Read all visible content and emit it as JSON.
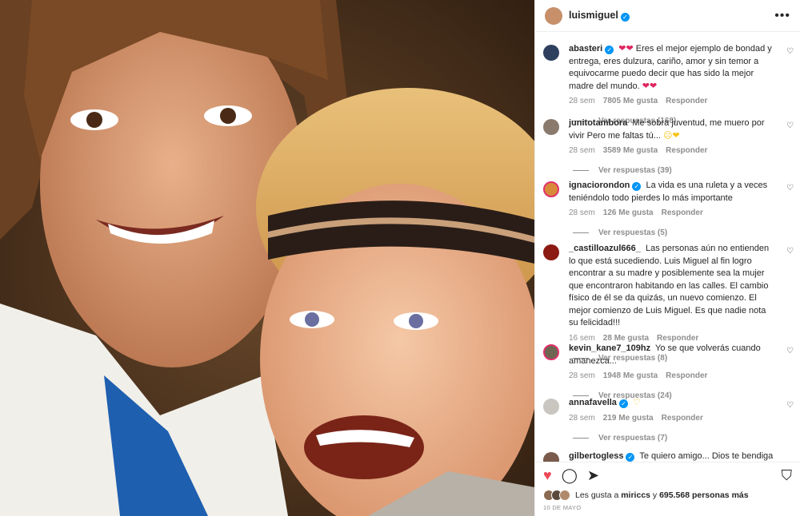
{
  "post": {
    "username": "luismiguel",
    "verified_mark": "✓",
    "more_icon": "more-options-icon",
    "more_label": "•••"
  },
  "comments": [
    {
      "username": "abasteri",
      "verified": true,
      "text_lead": "❤❤",
      "text": "Eres el mejor ejemplo de bondad y entrega, eres dulzura, cariño, amor y sin temor a equivocarme puedo decir que has sido la mejor madre del mundo.",
      "text_trail": "❤❤",
      "time": "28 sem",
      "likes": "7805 Me gusta",
      "reply": "Responder",
      "replies": "Ver respuestas (168)"
    },
    {
      "username": "junitotambora",
      "verified": false,
      "text": "Me sobra juventud, me muero por vivir Pero me faltas tú...",
      "text_trail": "☹❤",
      "time": "28 sem",
      "likes": "3589 Me gusta",
      "reply": "Responder",
      "replies": "Ver respuestas (39)"
    },
    {
      "username": "ignaciorondon",
      "verified": true,
      "text": "La vida es una ruleta y a veces teniéndolo todo pierdes lo más importante",
      "time": "28 sem",
      "likes": "126 Me gusta",
      "reply": "Responder",
      "replies": "Ver respuestas (5)"
    },
    {
      "username": "_castilloazul666_",
      "verified": false,
      "text": "Las personas aún no entienden lo que está sucediendo. Luis Miguel al fin logro encontrar a su madre y posiblemente sea la mujer que encontraron habitando en las calles. El cambio físico de él se da quizás, un nuevo comienzo. El mejor comienzo de Luis Miguel. Es que nadie nota su felicidad!!!",
      "time": "16 sem",
      "likes": "28 Me gusta",
      "reply": "Responder",
      "replies": "Ver respuestas (8)"
    },
    {
      "username": "kevin_kane7_109hz",
      "verified": false,
      "text": "Yo se que volverás cuando amanezca...",
      "time": "28 sem",
      "likes": "1948 Me gusta",
      "reply": "Responder",
      "replies": "Ver respuestas (24)"
    },
    {
      "username": "annafavella",
      "verified": true,
      "text": "",
      "text_trail": "♡",
      "time": "28 sem",
      "likes": "219 Me gusta",
      "reply": "Responder",
      "replies": "Ver respuestas (7)"
    },
    {
      "username": "gilbertogless",
      "verified": true,
      "text": "Te quiero amigo... Dios te bendiga",
      "time": "",
      "likes": "",
      "reply": "",
      "replies": ""
    }
  ],
  "comment_like_icon": "♡",
  "actions": {
    "like_icon": "♥",
    "comment_icon": "◯",
    "share_icon": "➤",
    "save_icon": "⛉"
  },
  "likes_summary": {
    "prefix": "Les gusta a",
    "user": "miriccs",
    "middle": "y",
    "count": "695.568 personas más"
  },
  "date": "10 DE MAYO",
  "colors": {
    "like_red": "#ed4956",
    "verified_blue": "#0095f6",
    "muted_text": "#8e8e8e"
  }
}
